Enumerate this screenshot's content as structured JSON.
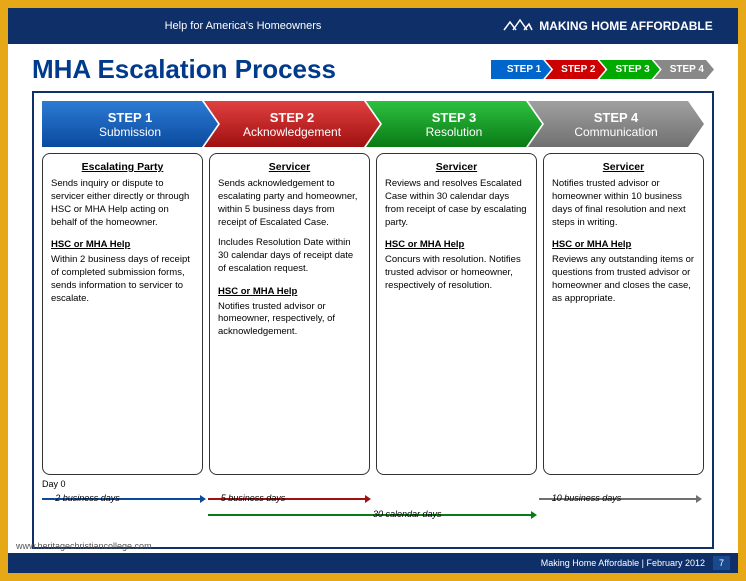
{
  "header": {
    "left": "Help for America's Homeowners",
    "brand": "MAKING HOME AFFORDABLE"
  },
  "title": "MHA Escalation Process",
  "mini_steps": [
    "STEP 1",
    "STEP 2",
    "STEP 3",
    "STEP 4"
  ],
  "steps": [
    {
      "num": "STEP 1",
      "name": "Submission"
    },
    {
      "num": "STEP 2",
      "name": "Acknowledgement"
    },
    {
      "num": "STEP 3",
      "name": "Resolution"
    },
    {
      "num": "STEP 4",
      "name": "Communication"
    }
  ],
  "cols": [
    {
      "title": "Escalating Party",
      "body": "Sends inquiry or dispute to servicer either directly or through HSC or MHA Help acting on behalf of the homeowner.",
      "sub": "HSC or MHA Help",
      "subbody": "Within 2 business days of receipt of completed submission forms, sends information to servicer to escalate."
    },
    {
      "title": "Servicer",
      "body": "Sends acknowledgement to escalating party and homeowner, within 5 business days from receipt of Escalated Case.",
      "body2": "Includes Resolution Date within 30 calendar days of receipt date of escalation request.",
      "sub": "HSC or MHA Help",
      "subbody": "Notifies trusted advisor or homeowner, respectively, of acknowledgement."
    },
    {
      "title": "Servicer",
      "body": "Reviews and resolves Escalated Case within 30 calendar days from receipt of case by escalating party.",
      "sub": "HSC or MHA Help",
      "subbody": "Concurs with resolution. Notifies trusted advisor or homeowner, respectively of resolution."
    },
    {
      "title": "Servicer",
      "body": "Notifies trusted advisor or homeowner within 10 business days of final resolution and next steps in writing.",
      "sub": "HSC or MHA Help",
      "subbody": "Reviews any outstanding items or questions from trusted advisor or homeowner and closes the case, as appropriate."
    }
  ],
  "timeline": {
    "day0": "Day 0",
    "t1": "2 business days",
    "t2": "5 business days",
    "t3": "30 calendar days",
    "t4": "10 business days"
  },
  "footer": {
    "text": "Making Home Affordable | February 2012",
    "page": "7"
  },
  "watermark": "www.heritagechristiancollege.com"
}
